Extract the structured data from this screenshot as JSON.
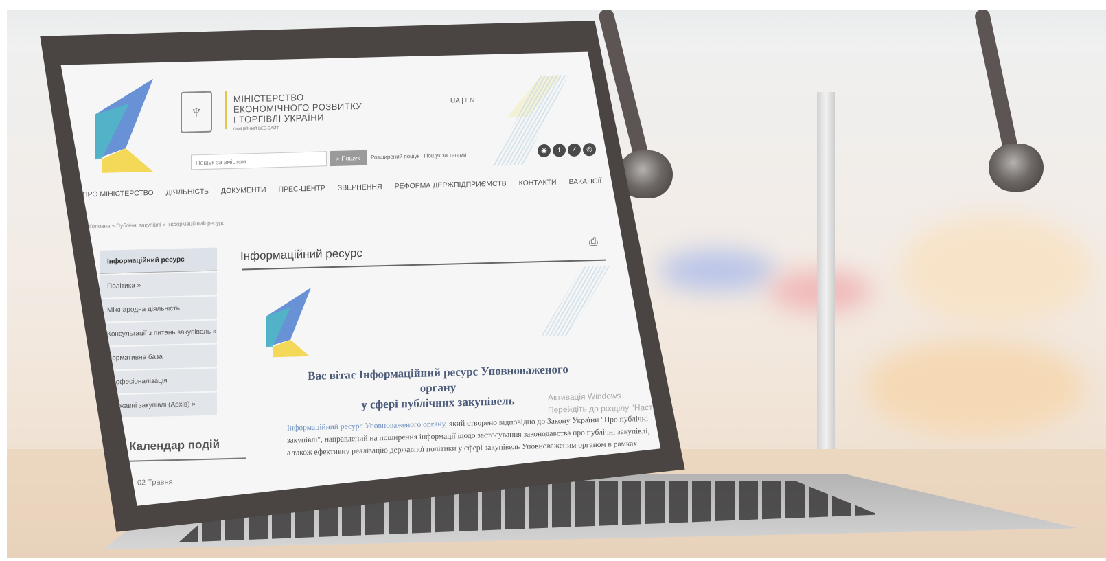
{
  "site": {
    "ministry_lines": [
      "МІНІСТЕРСТВО",
      "ЕКОНОМІЧНОГО РОЗВИТКУ",
      "І ТОРГІВЛІ УКРАЇНИ"
    ],
    "ministry_sub": "ОФІЦІЙНИЙ ВЕБ-САЙТ",
    "lang_ua": "UA",
    "lang_sep": "|",
    "lang_en": "EN",
    "search_placeholder": "Пошук за змістом",
    "search_button": "Пошук",
    "advanced_search": "Розширений пошук",
    "search_sep": "|",
    "search_tags": "Пошук за тегами",
    "nav": [
      "ПРО МІНІСТЕРСТВО",
      "ДІЯЛЬНІСТЬ",
      "ДОКУМЕНТИ",
      "ПРЕС-ЦЕНТР",
      "ЗВЕРНЕННЯ",
      "РЕФОРМА ДЕРЖПІДПРИЄМСТВ",
      "КОНТАКТИ",
      "ВАКАНСІЇ"
    ],
    "breadcrumb": "Головна » Публічні закупівлі » Інформаційний ресурс",
    "sidebar": [
      "Інформаційний ресурс",
      "Політика »",
      "Міжнародна діяльність",
      "Консультації з питань закупівель »",
      "Нормативна база",
      "Професіоналізація",
      "Державні закупівлі (Архів) »"
    ],
    "calendar_title": "Календар подій",
    "calendar_date": "02 Травня",
    "page_title": "Інформаційний ресурс",
    "welcome_line1": "Вас вітає Інформаційний ресурс Уповноваженого органу",
    "welcome_line2": "у сфері публічних закупівель",
    "para_link": "Інформаційний ресурс Уповноваженого органу",
    "para_rest1": ", який створено відповідно до Закону України \"Про публічні",
    "para_line2": "закупівлі\", направлений на поширення інформації щодо застосування законодавства про публічні закупівлі,",
    "para_line3": "а також ефективну реалізацію державної політики у сфері закупівель Уповноваженим органом в рамках",
    "watermark_line1": "Активація Windows",
    "watermark_line2": "Перейдіть до розділу \"Настройки\""
  },
  "colors": {
    "logo_blue": "#4f7fd0",
    "logo_teal": "#4fb9c6",
    "logo_yellow": "#f3d43d",
    "welcome_text": "#4a5a78"
  }
}
